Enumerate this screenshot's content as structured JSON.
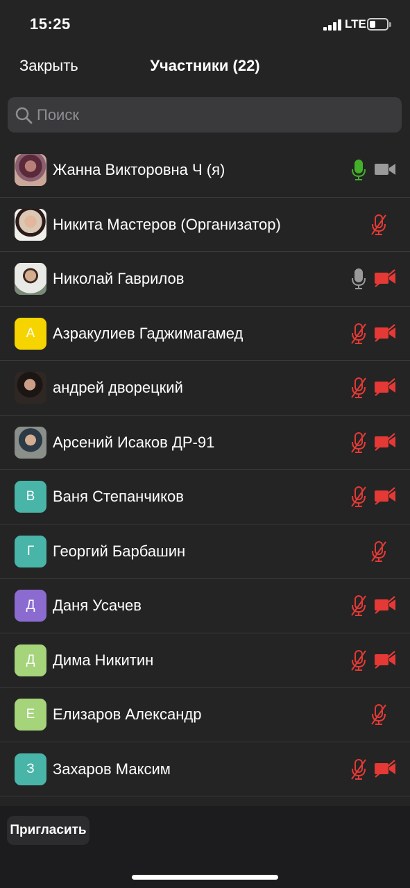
{
  "status_bar": {
    "time": "15:25",
    "network": "LTE"
  },
  "header": {
    "close_label": "Закрыть",
    "title": "Участники (22)"
  },
  "search": {
    "placeholder": "Поиск"
  },
  "participants": [
    {
      "name": "Жанна Викторовна Ч (я)",
      "avatar": "photo",
      "mic": "active",
      "video": "off-gray"
    },
    {
      "name": "Никита Мастеров (Организатор)",
      "avatar": "photo",
      "mic": "muted",
      "video": "none"
    },
    {
      "name": "Николай Гаврилов",
      "avatar": "photo",
      "mic": "on-gray",
      "video": "muted"
    },
    {
      "name": "Азракулиев Гаджимагамед",
      "avatar": "А",
      "avatar_color": "#f5d400",
      "mic": "muted",
      "video": "muted"
    },
    {
      "name": "андрей дворецкий",
      "avatar": "photo",
      "mic": "muted",
      "video": "muted"
    },
    {
      "name": "Арсений Исаков ДР-91",
      "avatar": "photo",
      "mic": "muted",
      "video": "muted"
    },
    {
      "name": "Ваня Степанчиков",
      "avatar": "В",
      "avatar_color": "#48b5a8",
      "mic": "muted",
      "video": "muted"
    },
    {
      "name": "Георгий Барбашин",
      "avatar": "Г",
      "avatar_color": "#48b5a8",
      "mic": "muted",
      "video": "none"
    },
    {
      "name": "Даня Усачев",
      "avatar": "Д",
      "avatar_color": "#8b6bd0",
      "mic": "muted",
      "video": "muted"
    },
    {
      "name": "Дима Никитин",
      "avatar": "Д",
      "avatar_color": "#a5d47a",
      "mic": "muted",
      "video": "muted"
    },
    {
      "name": "Елизаров Александр",
      "avatar": "Е",
      "avatar_color": "#a5d47a",
      "mic": "muted",
      "video": "none"
    },
    {
      "name": "Захаров Максим",
      "avatar": "З",
      "avatar_color": "#48b5a8",
      "mic": "muted",
      "video": "muted"
    }
  ],
  "footer": {
    "invite_label": "Пригласить"
  },
  "colors": {
    "background": "#242424",
    "muted_red": "#e53935",
    "active_green": "#43b02a",
    "neutral_gray": "#9a9a9a"
  }
}
